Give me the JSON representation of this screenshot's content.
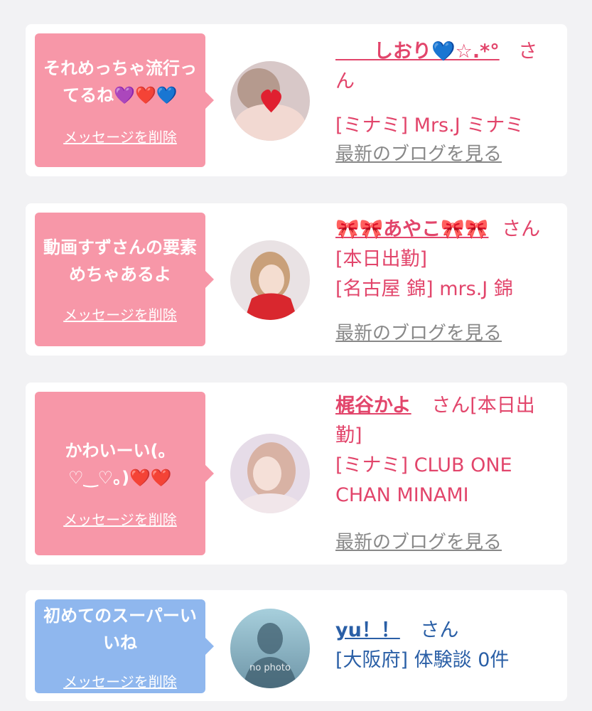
{
  "cards": [
    {
      "message": "それめっちゃ流行ってるね💜❤️💙",
      "delete_label": "メッセージを削除",
      "user_name": "しおり💙☆.*°",
      "user_name_prefix": "＿＿",
      "san": "さん",
      "shop": "[ミナミ] Mrs.J ミナミ",
      "blog_link": "最新のブログを見る"
    },
    {
      "message": "動画すずさんの要素めちゃあるよ",
      "delete_label": "メッセージを削除",
      "user_name": "🎀🎀あやこ🎀🎀",
      "san": "さん[本日出勤]",
      "shop": "[名古屋 錦] mrs.J 錦",
      "blog_link": "最新のブログを見る"
    },
    {
      "message": "かわいーい(。♡‿♡。)❤️❤️",
      "delete_label": "メッセージを削除",
      "user_name": "梶谷かよ",
      "san": "さん[本日出勤]",
      "shop": "[ミナミ] CLUB ONE CHAN MINAMI",
      "blog_link": "最新のブログを見る"
    },
    {
      "message": "初めてのスーパーいいね",
      "delete_label": "メッセージを削除",
      "user_name": "yu！！",
      "san": "さん",
      "shop": "[大阪府] 体験談 0件",
      "no_photo": "no photo"
    }
  ],
  "colors": {
    "pink_bubble": "#f797a8",
    "blue_bubble": "#8fb7ee",
    "pink_text": "#e2456b",
    "blue_text": "#2a5fa6"
  }
}
